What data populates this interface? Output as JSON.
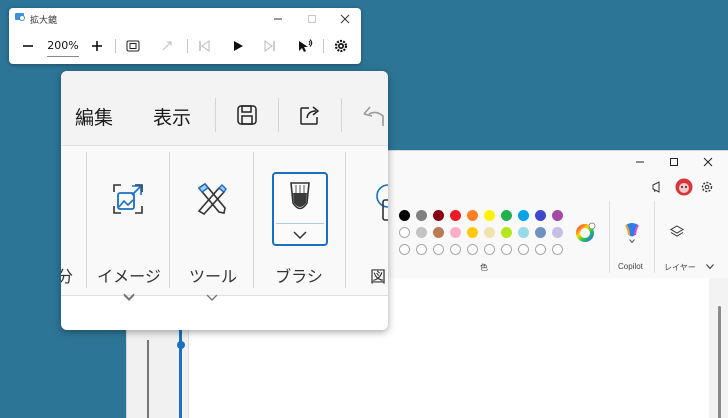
{
  "magnifier": {
    "title": "拡大鏡",
    "zoom_level": "200%"
  },
  "zoomed_view": {
    "menu_items": [
      "編集",
      "表示"
    ],
    "ribbon_groups": {
      "left_partial": "分",
      "image": "イメージ",
      "tools": "ツール",
      "brushes": "ブラシ",
      "shapes_partial": "図"
    }
  },
  "paint": {
    "labels": {
      "colors": "色",
      "copilot": "Copilot",
      "layers": "レイヤー"
    }
  },
  "colors": {
    "accent": "#1a6fc0",
    "desktop": "#2d7596",
    "palette_row1": [
      "#000000",
      "#7f7f7f",
      "#880015",
      "#ed1c24",
      "#ff7f27",
      "#fff200",
      "#22b14c",
      "#00a2e8",
      "#3f48cc",
      "#a349a4"
    ],
    "palette_row2": [
      "#ffffff",
      "#c3c3c3",
      "#b97a57",
      "#ffaec9",
      "#ffc90e",
      "#efe4b0",
      "#b5e61d",
      "#99d9ea",
      "#7092be",
      "#c8bfe7"
    ]
  }
}
